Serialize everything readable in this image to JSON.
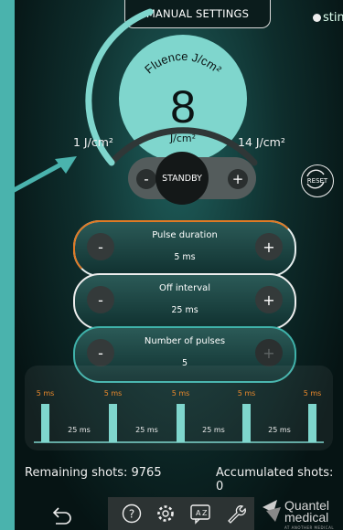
{
  "header": {
    "title": "MANUAL SETTINGS",
    "brand": "stim"
  },
  "fluence": {
    "label": "Fluence J/cm²",
    "value": "8",
    "unit": "J/cm²",
    "min_label": "1 J/cm²",
    "max_label": "14 J/cm²"
  },
  "controls": {
    "minus": "-",
    "plus": "+",
    "standby": "STANDBY",
    "reset": "RESET"
  },
  "params": [
    {
      "label": "Pulse duration",
      "value": "5 ms",
      "minus": "-",
      "plus": "+"
    },
    {
      "label": "Off interval",
      "value": "25 ms",
      "minus": "-",
      "plus": "+"
    },
    {
      "label": "Number of pulses",
      "value": "5",
      "minus": "-",
      "plus": "+"
    }
  ],
  "timeline": {
    "pulse_labels": [
      "5 ms",
      "5 ms",
      "5 ms",
      "5 ms",
      "5 ms"
    ],
    "gap_labels": [
      "25 ms",
      "25 ms",
      "25 ms",
      "25 ms"
    ]
  },
  "counters": {
    "remaining": "Remaining shots: 9765",
    "accumulated": "Accumulated shots: 0"
  },
  "logo": {
    "line1": "Quantel",
    "line2": "medical",
    "tagline": "AT ANOTHER MEDICAL"
  },
  "colors": {
    "accent": "#7fd6cd",
    "highlight": "#e07a24",
    "pulse_label": "#e8882c",
    "background": "#4ab3ad"
  }
}
